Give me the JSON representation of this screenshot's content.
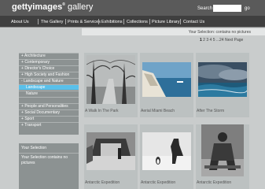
{
  "header": {
    "logo_brand": "gettyimages",
    "logo_mark": "®",
    "logo_gallery": " gallery",
    "search_label": "Search",
    "search_value": "",
    "go_label": "go"
  },
  "nav": {
    "items": [
      {
        "label": "About Us"
      },
      {
        "label": "The Gallery"
      },
      {
        "label": "Prints & Services"
      },
      {
        "label": "Exhibitions"
      },
      {
        "label": "Collections"
      },
      {
        "label": "Picture Library"
      },
      {
        "label": "Contact Us"
      }
    ]
  },
  "selection_bar": {
    "text": "Your Selection: contains no pictures"
  },
  "pager": {
    "pages": [
      "1",
      "2",
      "3",
      "4",
      "5",
      "...24"
    ],
    "next_label": "Next Page"
  },
  "sidebar": {
    "items": [
      {
        "label": "Architecture",
        "bullet": "+"
      },
      {
        "label": "Contemporary",
        "bullet": "+"
      },
      {
        "label": "Director's Choice",
        "bullet": "+"
      },
      {
        "label": "High Society and Fashion",
        "bullet": "+"
      },
      {
        "label": "Landscape and Nature",
        "bullet": "-"
      },
      {
        "label": "Landscape",
        "bullet": ""
      },
      {
        "label": "Nature",
        "bullet": ""
      },
      {
        "label": "",
        "bullet": ""
      },
      {
        "label": "People and Personalities",
        "bullet": "+"
      },
      {
        "label": "Social Documentary",
        "bullet": "+"
      },
      {
        "label": "Sport",
        "bullet": "+"
      },
      {
        "label": "Transport",
        "bullet": "+"
      }
    ]
  },
  "lightbox": {
    "title": "Your Selection",
    "text": "Your Selection contains no pictures"
  },
  "gallery": {
    "items": [
      {
        "caption": "A Walk In The Park"
      },
      {
        "caption": "Aerial Miami Beach"
      },
      {
        "caption": "After The Storm"
      },
      {
        "caption": "Antarctic Expedition"
      },
      {
        "caption": "Antarctic Expedition"
      },
      {
        "caption": "Antarctic Expedition"
      }
    ]
  },
  "colors": {
    "header_bg": "#5a5a5a",
    "nav_bg": "#3f3f3f",
    "page_bg": "#c9cccc",
    "sidebar_bg": "#8c9292",
    "active_item": "#59c0ea"
  }
}
